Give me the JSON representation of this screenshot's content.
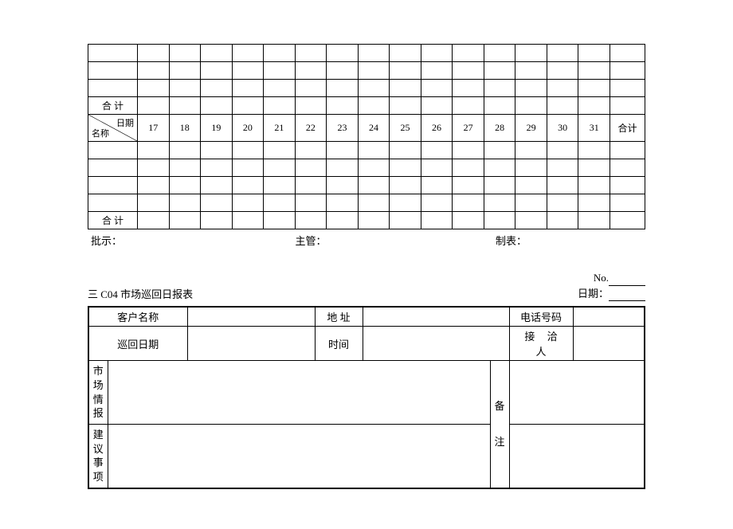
{
  "table1": {
    "header_top": "日期",
    "header_bottom": "名称",
    "days": [
      "17",
      "18",
      "19",
      "20",
      "21",
      "22",
      "23",
      "24",
      "25",
      "26",
      "27",
      "28",
      "29",
      "30",
      "31"
    ],
    "total_label": "合计",
    "subtotal_label": "合 计"
  },
  "footer": {
    "approve": "批示：",
    "supervisor": "主管：",
    "preparer": "制表："
  },
  "section2": {
    "title": "三 C04  市场巡回日报表",
    "no_label": "No.",
    "date_label": "日期：",
    "row_labels": {
      "customer": "客户名称",
      "address": "地 址",
      "phone": "电话号码",
      "tour_date": "巡回日期",
      "time": "时间",
      "receiver": "接 洽 人"
    },
    "vcol1_chars": [
      "市",
      "场",
      "情",
      "报"
    ],
    "vcol2_chars": [
      "建",
      "议",
      "事",
      "项"
    ],
    "remark_chars": [
      "备",
      "注"
    ]
  }
}
